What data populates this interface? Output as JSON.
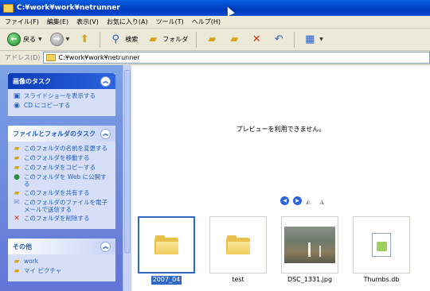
{
  "window": {
    "title": "C:¥work¥work¥netrunner"
  },
  "menu": [
    "ファイル(F)",
    "編集(E)",
    "表示(V)",
    "お気に入り(A)",
    "ツール(T)",
    "ヘルプ(H)"
  ],
  "toolbar": {
    "back_label": "戻る",
    "search_label": "検索",
    "folders_label": "フォルダ"
  },
  "address": {
    "label": "アドレス(D)",
    "value": "C:¥work¥work¥netrunner"
  },
  "tasks": {
    "picture": {
      "title": "画像のタスク",
      "items": [
        "スライドショーを表示する",
        "CD にコピーする"
      ]
    },
    "file_folder": {
      "title": "ファイルとフォルダのタスク",
      "items": [
        "このフォルダの名前を変更する",
        "このフォルダを移動する",
        "このフォルダをコピーする",
        "このフォルダを Web に公開する",
        "このフォルダを共有する",
        "このフォルダのファイルを電子メールで送信する",
        "このフォルダを削除する"
      ]
    },
    "other": {
      "title": "その他",
      "items": [
        "work",
        "マイ ピクチャ"
      ]
    }
  },
  "preview": {
    "message": "プレビューを利用できません。"
  },
  "files": [
    {
      "name": "2007_04",
      "type": "folder",
      "selected": true
    },
    {
      "name": "test",
      "type": "folder",
      "selected": false
    },
    {
      "name": "DSC_1331.jpg",
      "type": "photo",
      "selected": false
    },
    {
      "name": "Thumbs.db",
      "type": "db",
      "selected": false
    }
  ]
}
